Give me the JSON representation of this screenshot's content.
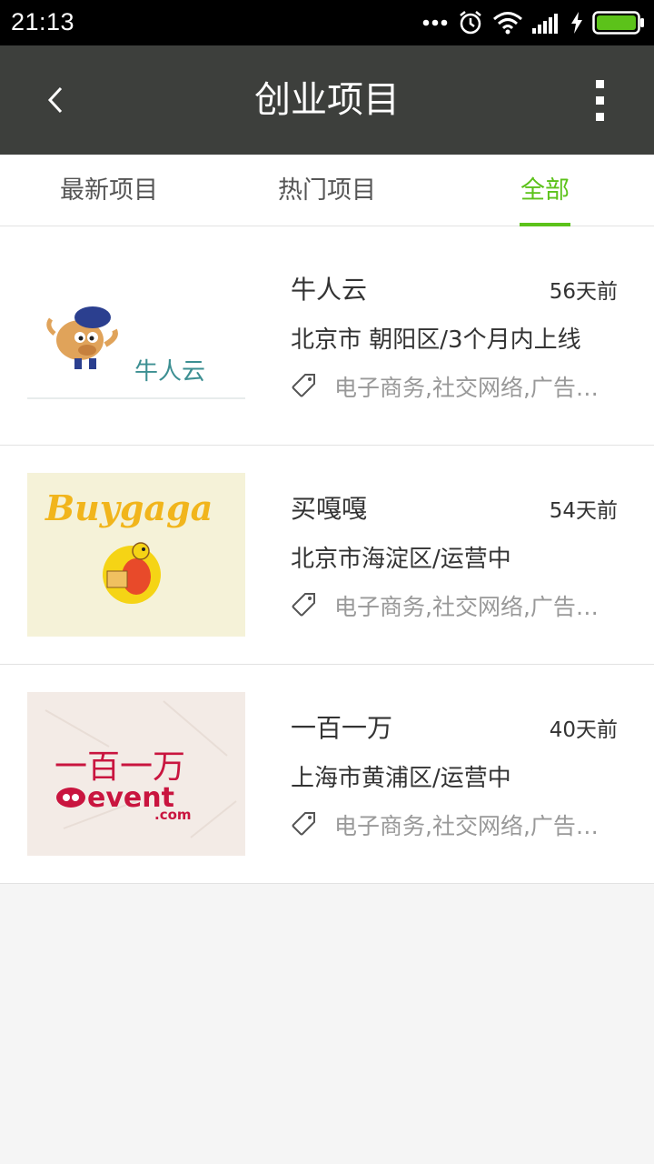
{
  "status_bar": {
    "time": "21:13",
    "icons": [
      "more-dots-icon",
      "alarm-icon",
      "wifi-icon",
      "signal-icon",
      "charging-bolt-icon",
      "battery-icon"
    ],
    "battery_color": "#5cc21a"
  },
  "app_bar": {
    "title": "创业项目",
    "back_icon": "back-arrow-icon",
    "menu_icon": "overflow-menu-icon",
    "bg_color": "#3d3f3c"
  },
  "tabs": [
    {
      "label": "最新项目",
      "active": false
    },
    {
      "label": "热门项目",
      "active": false
    },
    {
      "label": "全部",
      "active": true
    }
  ],
  "accent_color": "#5cc21a",
  "projects": [
    {
      "name": "牛人云",
      "ago": "56天前",
      "location": "北京市 朝阳区/3个月内上线",
      "tags": "电子商务,社交网络,广告…",
      "logo_text": "牛人云"
    },
    {
      "name": "买嘎嘎",
      "ago": "54天前",
      "location": "北京市海淀区/运营中",
      "tags": "电子商务,社交网络,广告…",
      "logo_text": "Buygaga"
    },
    {
      "name": "一百一万",
      "ago": "40天前",
      "location": "上海市黄浦区/运营中",
      "tags": "电子商务,社交网络,广告…",
      "logo_text": "一百一万",
      "logo_sub": "event",
      "logo_sub2": ".com"
    }
  ]
}
